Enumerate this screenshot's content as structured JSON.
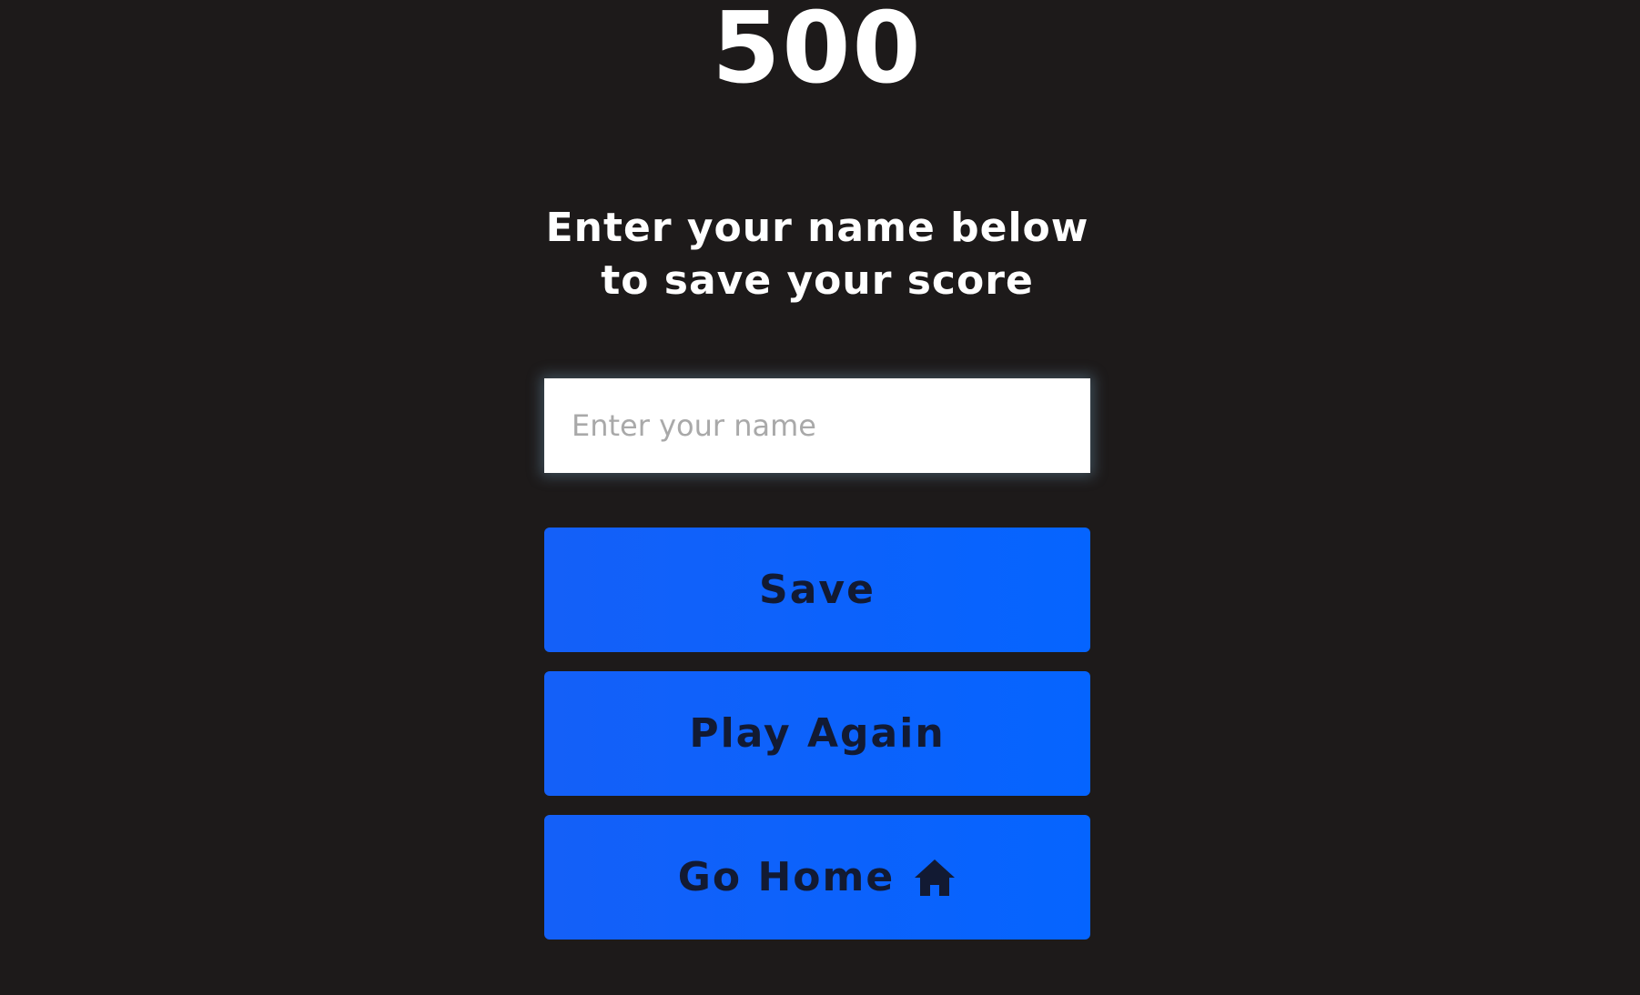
{
  "score": {
    "value": "500"
  },
  "prompt": {
    "text": "Enter your name below to save your score"
  },
  "name_input": {
    "value": "",
    "placeholder": "Enter your name"
  },
  "buttons": {
    "save_label": "Save",
    "play_again_label": "Play Again",
    "go_home_label": "Go Home",
    "go_home_icon": "home-icon"
  },
  "colors": {
    "background": "#1d1a1a",
    "button_bg": "#0d62fb",
    "button_text": "#121a33",
    "text": "#ffffff"
  }
}
